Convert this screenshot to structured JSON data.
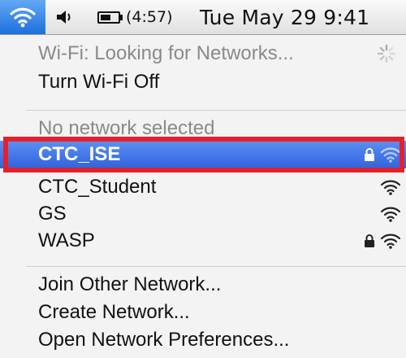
{
  "menubar": {
    "wifi_icon": "wifi-icon",
    "speaker_icon": "speaker-icon",
    "battery_icon": "battery-icon",
    "battery_time": "(4:57)",
    "clock": "Tue May 29  9:41"
  },
  "menu": {
    "status": "Wi-Fi: Looking for Networks...",
    "toggle": "Turn Wi-Fi Off",
    "no_network": "No network selected",
    "networks": [
      {
        "name": "CTC_ISE",
        "locked": true,
        "selected": true
      },
      {
        "name": "CTC_Student",
        "locked": false,
        "selected": false
      },
      {
        "name": "GS",
        "locked": false,
        "selected": false
      },
      {
        "name": "WASP",
        "locked": true,
        "selected": false
      }
    ],
    "join_other": "Join Other Network...",
    "create": "Create Network...",
    "preferences": "Open Network Preferences..."
  },
  "colors": {
    "selection": "#2f64e0",
    "annotation_box": "#e3212c",
    "menubar_wifi_tab": "#1e6fdc"
  }
}
